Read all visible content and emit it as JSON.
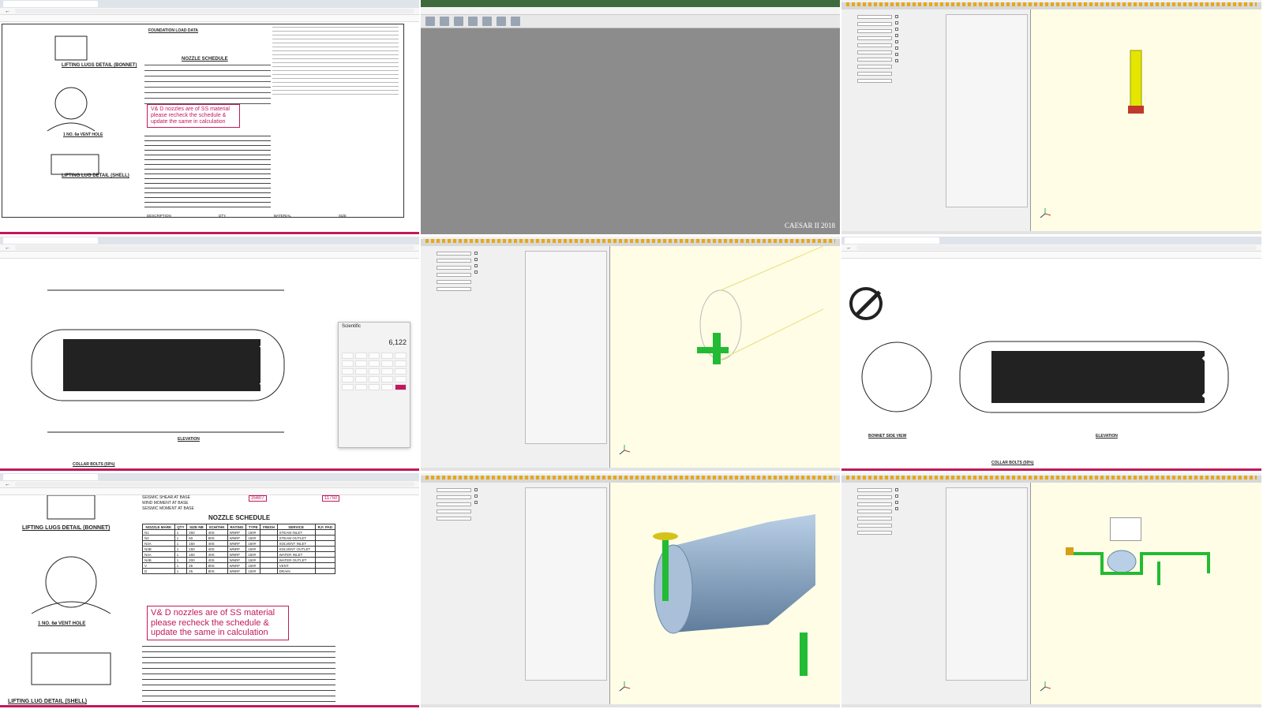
{
  "cells": {
    "pdf1": {
      "labels": {
        "lifting_lug_bonnet": "LIFTING LUGS DETAIL (BONNET)",
        "lifting_lug_shell": "LIFTING LUG DETAIL (SHELL)",
        "vent_hole": "1 NO. 6ø VENT HOLE",
        "foundation": "FOUNDATION LOAD DATA",
        "nozzle_schedule": "NOZZLE SCHEDULE",
        "description": "DESCRIPTION",
        "qty": "QTY.",
        "material": "MATERIAL",
        "size": "SIZE"
      },
      "note": "V& D nozzles are of SS material please recheck the schedule & update the same in calculation"
    },
    "caesar1": {
      "brand": "CAESAR II 2018"
    },
    "pdf2": {
      "elevation": "ELEVATION",
      "collar_bolts": "COLLAR BOLTS (50%)",
      "calculator": {
        "mode": "Scientific",
        "display": "6,122"
      }
    },
    "pdf3": {
      "elevation": "ELEVATION",
      "bonnet_view": "BONNET SIDE VIEW",
      "collar_bolts": "COLLAR BOLTS (50%)"
    },
    "pdf4": {
      "lifting_lug_bonnet": "LIFTING LUGS DETAIL (BONNET)",
      "lifting_lug_shell": "LIFTING LUG DETAIL (SHELL)",
      "vent_hole": "1 NO. 6ø VENT HOLE",
      "nozzle_schedule": "NOZZLE SCHEDULE",
      "note": "V& D nozzles are of SS material please recheck the schedule & update the same in calculation",
      "seismic_shear": "SEISMIC SHEAR AT BASE",
      "wind_moment": "WIND MOMENT AT BASE",
      "seismic_moment": "SEISMIC MOMENT AT BASE",
      "mark_1": "35607",
      "mark_2": "11750",
      "headers": [
        "NOZZLE MARK",
        "QTY",
        "SIZE NB",
        "SCH/THK",
        "RATING",
        "TYPE",
        "FINISH",
        "SERVICE",
        "R.F. PAD"
      ],
      "rows": [
        [
          "N1",
          "1",
          "250",
          "40S",
          "WNRF",
          "150#",
          "",
          "STEAM INLET",
          ""
        ],
        [
          "N2",
          "1",
          "50",
          "80S",
          "WNRF",
          "150#",
          "",
          "STEAM OUTLET",
          ""
        ],
        [
          "N3A",
          "1",
          "150",
          "40S",
          "WNRF",
          "150#",
          "",
          "SOLVENT INLET",
          ""
        ],
        [
          "N3B",
          "1",
          "150",
          "40S",
          "WNRF",
          "150#",
          "",
          "SOLVENT OUTLET",
          ""
        ],
        [
          "N4A",
          "1",
          "150",
          "40S",
          "WNRF",
          "150#",
          "",
          "WATER INLET",
          ""
        ],
        [
          "N4B",
          "1",
          "200",
          "40S",
          "WNRF",
          "150#",
          "",
          "WATER OUTLET",
          ""
        ],
        [
          "V",
          "1",
          "25",
          "80S",
          "WNRF",
          "150#",
          "",
          "VENT",
          ""
        ],
        [
          "D",
          "1",
          "25",
          "80S",
          "WNRF",
          "150#",
          "",
          "DRAIN",
          ""
        ]
      ]
    }
  }
}
